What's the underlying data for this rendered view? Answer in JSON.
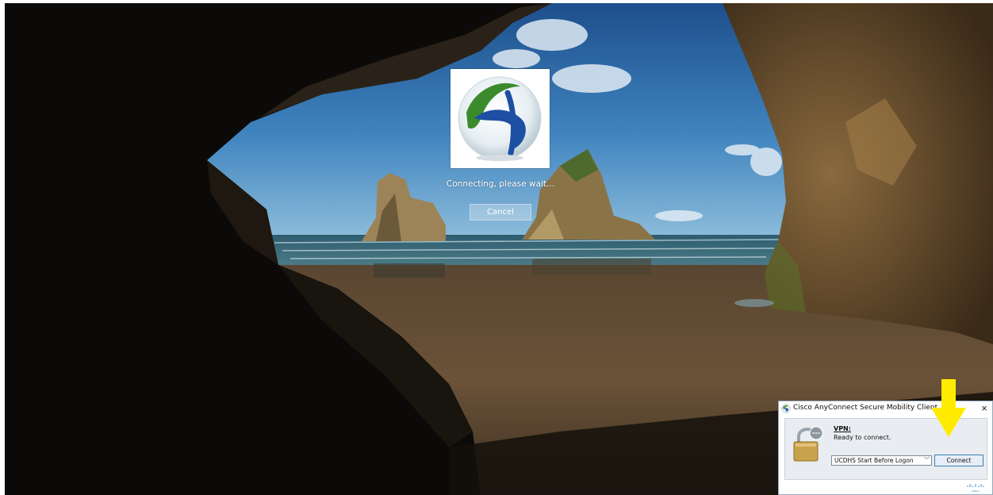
{
  "login_screen": {
    "status_text": "Connecting, please wait...",
    "cancel_label": "Cancel",
    "logo_icon": "anyconnect-globe-icon"
  },
  "vpn_window": {
    "title": "Cisco AnyConnect Secure Mobility Client",
    "close_label": "×",
    "section_label": "VPN:",
    "status": "Ready to connect.",
    "selected_profile": "UCDHS Start Before Logon",
    "connect_label": "Connect",
    "footer_logo_text": "cisco"
  },
  "annotation": {
    "arrow_color": "#ffeb00",
    "arrow_icon": "down-arrow-icon"
  },
  "colors": {
    "vpn_body": "#e9edf1",
    "connect_border": "#3c7fb1"
  }
}
